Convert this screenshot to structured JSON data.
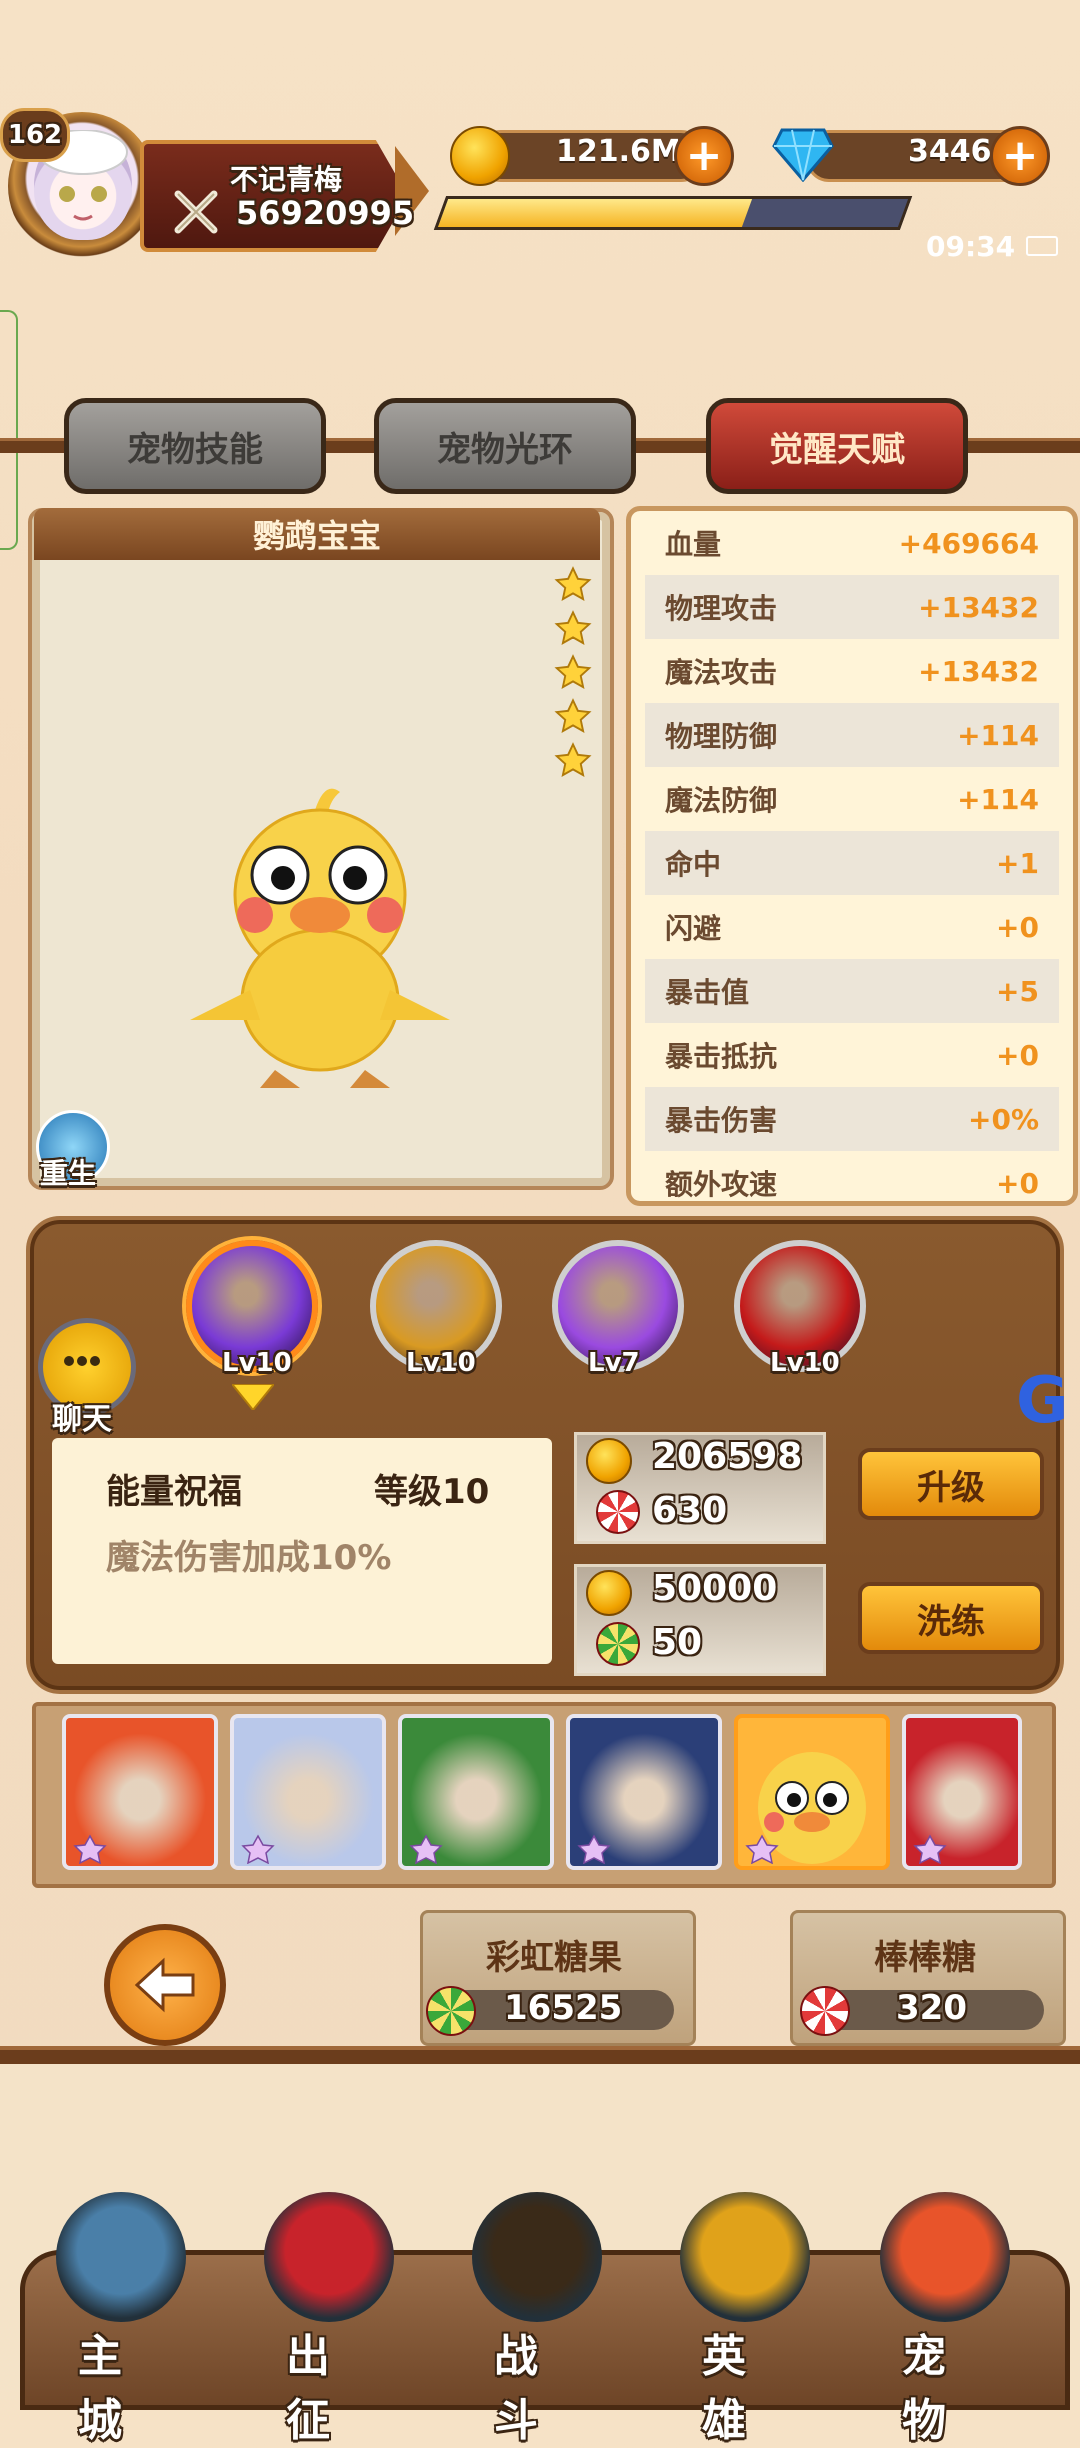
{
  "player": {
    "level": "162",
    "name": "不记青梅",
    "power": "56920995"
  },
  "resources": {
    "gold": "121.6M",
    "diamonds": "3446",
    "xp_fraction": 0.66
  },
  "status": {
    "time": "09:34"
  },
  "tabs": [
    "宠物技能",
    "宠物光环",
    "觉醒天赋"
  ],
  "pet": {
    "name": "鹦鹉宝宝",
    "stars": 5,
    "rebirth_label": "重生"
  },
  "stats": [
    {
      "name": "血量",
      "value": "+469664"
    },
    {
      "name": "物理攻击",
      "value": "+13432"
    },
    {
      "name": "魔法攻击",
      "value": "+13432"
    },
    {
      "name": "物理防御",
      "value": "+114"
    },
    {
      "name": "魔法防御",
      "value": "+114"
    },
    {
      "name": "命中",
      "value": "+1"
    },
    {
      "name": "闪避",
      "value": "+0"
    },
    {
      "name": "暴击值",
      "value": "+5"
    },
    {
      "name": "暴击抵抗",
      "value": "+0"
    },
    {
      "name": "暴击伤害",
      "value": "+0%"
    },
    {
      "name": "额外攻速",
      "value": "+0"
    }
  ],
  "skills": [
    {
      "level": "Lv10",
      "color": "#7a3ad6"
    },
    {
      "level": "Lv10",
      "color": "#d99a22"
    },
    {
      "level": "Lv7",
      "color": "#9a4ae0"
    },
    {
      "level": "Lv10",
      "color": "#c41a1a"
    }
  ],
  "chat_label": "聊天",
  "skill_detail": {
    "name": "能量祝福",
    "level": "等级10",
    "description": "魔法伤害加成10%"
  },
  "upgrade": {
    "gold": "206598",
    "candy": "630",
    "button": "升级"
  },
  "refine": {
    "gold": "50000",
    "candy": "50",
    "button": "洗练"
  },
  "roster_colors": [
    "#e8542a",
    "#b9c8ea",
    "#3b8a3a",
    "#2b3f78",
    "#ffb63a",
    "#c8232b"
  ],
  "candies": [
    {
      "title": "彩虹糖果",
      "value": "16525"
    },
    {
      "title": "棒棒糖",
      "value": "320"
    }
  ],
  "nav": [
    "主城",
    "出征",
    "战斗",
    "英雄",
    "宠物"
  ],
  "colors": {
    "accent_orange": "#f0921e",
    "tab_active": "#b82c20"
  }
}
